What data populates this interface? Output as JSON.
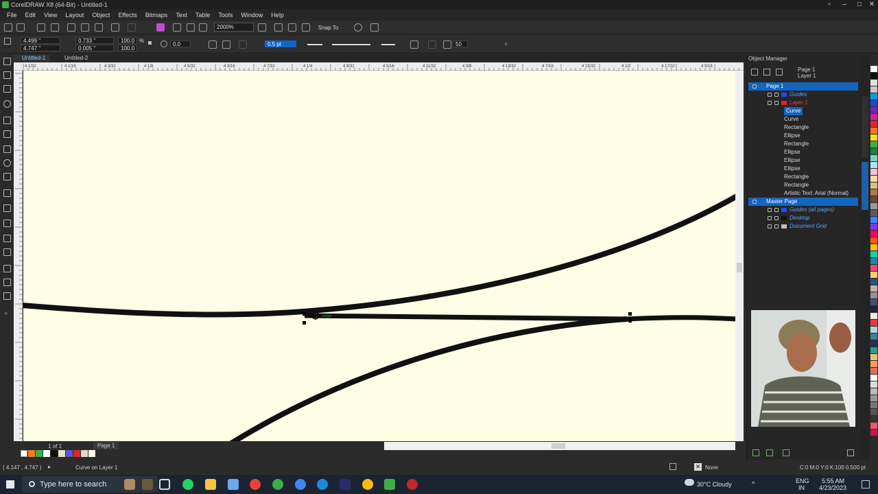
{
  "window": {
    "title": "CorelDRAW X8 (64-Bit) - Untitled-1",
    "controls": [
      "▫",
      "–",
      "□",
      "✕"
    ]
  },
  "menu": [
    "File",
    "Edit",
    "View",
    "Layout",
    "Object",
    "Effects",
    "Bitmaps",
    "Text",
    "Table",
    "Tools",
    "Window",
    "Help"
  ],
  "toolbar": {
    "zoom": "2000%",
    "snap_to": "Snap To"
  },
  "property_bar": {
    "x": "4.499 \"",
    "y": "4.747 \"",
    "width": "0.733 \"",
    "height": "0.005 \"",
    "scale_w": "100.0",
    "scale_h": "100.0",
    "percent": "%",
    "angle": "0.0",
    "outline_width": "0.5 pt",
    "smoothing": "50"
  },
  "doc_tabs": [
    "Untitled-1",
    "Untitled-2"
  ],
  "ruler_labels": [
    "4 1/32",
    "4 1/16",
    "4 3/32",
    "4 1/8",
    "4 5/32",
    "4 3/16",
    "4 7/32",
    "4 1/4",
    "4 9/32",
    "4 5/16",
    "4 11/32",
    "4 3/8",
    "4 13/32",
    "4 7/16",
    "4 15/32",
    "4 1/2",
    "4 17/32",
    "4 9/16"
  ],
  "canvas": {
    "cursor_label": "edge"
  },
  "page_nav": {
    "position": "1 of 1",
    "page_tab": "Page 1"
  },
  "status": {
    "coords": "( 4.147 , 4.747 )",
    "arrow": "▸",
    "object_info": "Curve on Layer 1",
    "fill_label": "None",
    "outline_info": "C:0 M:0 Y:0 K:100  0.500 pt"
  },
  "object_manager": {
    "title": "Object Manager",
    "page_header": "Page 1",
    "layer_header": "Layer 1",
    "rows": [
      {
        "label": "Page 1",
        "indent": 0,
        "type": "page",
        "highlight": true
      },
      {
        "label": "Guides",
        "indent": 1,
        "type": "layer",
        "color": "#1d4cff",
        "italic": true
      },
      {
        "label": "Layer 1",
        "indent": 1,
        "type": "layer",
        "color": "#e32222",
        "italic": true
      },
      {
        "label": "Curve",
        "indent": 2,
        "type": "obj",
        "selected": true
      },
      {
        "label": "Curve",
        "indent": 2,
        "type": "obj"
      },
      {
        "label": "Rectangle",
        "indent": 2,
        "type": "obj"
      },
      {
        "label": "Ellipse",
        "indent": 2,
        "type": "obj"
      },
      {
        "label": "Rectangle",
        "indent": 2,
        "type": "obj"
      },
      {
        "label": "Ellipse",
        "indent": 2,
        "type": "obj"
      },
      {
        "label": "Ellipse",
        "indent": 2,
        "type": "obj"
      },
      {
        "label": "Ellipse",
        "indent": 2,
        "type": "obj"
      },
      {
        "label": "Rectangle",
        "indent": 2,
        "type": "obj"
      },
      {
        "label": "Rectangle",
        "indent": 2,
        "type": "obj"
      },
      {
        "label": "Artistic Text: Arial (Normal) (EN",
        "indent": 2,
        "type": "obj"
      },
      {
        "label": "Master Page",
        "indent": 0,
        "type": "page",
        "highlight": true
      },
      {
        "label": "Guides (all pages)",
        "indent": 1,
        "type": "layer",
        "color": "#1d4cff",
        "italic": true
      },
      {
        "label": "Desktop",
        "indent": 1,
        "type": "layer",
        "color": "#111111",
        "italic": true
      },
      {
        "label": "Document Grid",
        "indent": 1,
        "type": "layer",
        "color": "#c9c0a8",
        "italic": true
      }
    ]
  },
  "colors": {
    "canvas": "#fffde6",
    "selection": "#1464c0",
    "curve": "#111111"
  },
  "taskbar": {
    "search_placeholder": "Type here to search",
    "weather": "30°C  Cloudy",
    "lang": "ENG",
    "lang2": "IN",
    "time": "5:55 AM",
    "date": "4/23/2023"
  }
}
